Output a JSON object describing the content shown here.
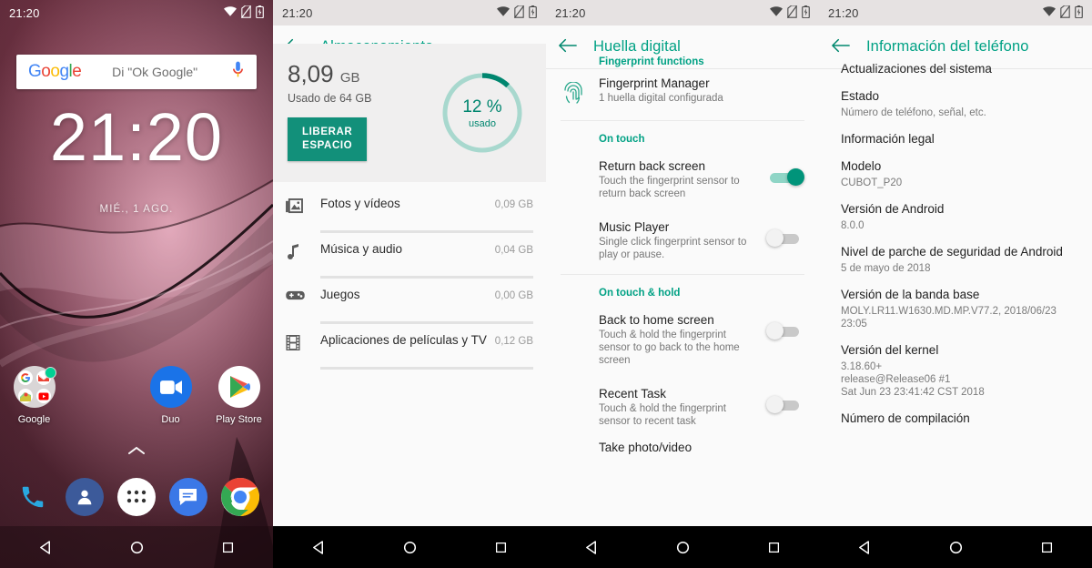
{
  "status_bar": {
    "time": "21:20",
    "icons": [
      "wifi-icon",
      "no-sim-icon",
      "battery-charging-icon"
    ]
  },
  "colors": {
    "accent_teal": "#00a184",
    "accent_teal_dark": "#00866f",
    "button_green": "#12907a",
    "toggle_on": "#00947a",
    "wallpaper_base": "#5c2a38"
  },
  "home_screen": {
    "search": {
      "logo": "Google",
      "placeholder": "Di \"Ok Google\"",
      "mic_icon": "microphone-icon"
    },
    "clock": "21:20",
    "date": "MIÉ., 1 AGO.",
    "apps": [
      {
        "label": "Google",
        "icon": "google-folder-icon"
      },
      {
        "label": "",
        "icon": ""
      },
      {
        "label": "Duo",
        "icon": "duo-icon"
      },
      {
        "label": "Play Store",
        "icon": "play-store-icon"
      }
    ],
    "drawer_arrow": "chevron-up-icon",
    "dock": [
      {
        "icon": "phone-icon",
        "label": "Teléfono"
      },
      {
        "icon": "contacts-icon",
        "label": "Contactos"
      },
      {
        "icon": "app-drawer-icon",
        "label": "Aplicaciones"
      },
      {
        "icon": "messages-icon",
        "label": "Mensajes"
      },
      {
        "icon": "chrome-icon",
        "label": "Chrome"
      }
    ]
  },
  "nav_bar": {
    "back": "back-triangle-icon",
    "home": "home-circle-icon",
    "recents": "recents-square-icon"
  },
  "storage_screen": {
    "back_icon": "back-arrow-icon",
    "title": "Almacenamiento",
    "used_size": "8,09",
    "used_unit": "GB",
    "used_of": "Usado de 64 GB",
    "free_button": "LIBERAR ESPACIO",
    "free_button_line1": "LIBERAR",
    "free_button_line2": "ESPACIO",
    "ring_percent": "12 %",
    "ring_percent_value": 12,
    "ring_label": "usado",
    "categories": [
      {
        "icon": "photos-icon",
        "name": "Fotos y vídeos",
        "size": "0,09 GB"
      },
      {
        "icon": "music-icon",
        "name": "Música y audio",
        "size": "0,04 GB"
      },
      {
        "icon": "games-icon",
        "name": "Juegos",
        "size": "0,00 GB"
      },
      {
        "icon": "movies-icon",
        "name": "Aplicaciones de películas y TV",
        "size": "0,12 GB"
      }
    ]
  },
  "fingerprint_screen": {
    "back_icon": "back-arrow-icon",
    "title": "Huella digital",
    "section_functions": "Fingerprint functions",
    "manager": {
      "icon": "fingerprint-icon",
      "title": "Fingerprint Manager",
      "subtitle": "1 huella digital configurada"
    },
    "section_on_touch": "On touch",
    "section_on_touch_hold": "On touch & hold",
    "items": [
      {
        "title": "Return back screen",
        "subtitle": "Touch the fingerprint sensor to return back screen",
        "toggle": "on"
      },
      {
        "title": "Music Player",
        "subtitle": "Single click fingerprint sensor to play or pause.",
        "toggle": "off"
      },
      {
        "title": "Back to home screen",
        "subtitle": "Touch & hold the fingerprint sensor to go back to the home screen",
        "toggle": "off"
      },
      {
        "title": "Recent Task",
        "subtitle": "Touch & hold the fingerprint sensor to recent task",
        "toggle": "off"
      }
    ],
    "last_partial": "Take photo/video"
  },
  "about_screen": {
    "back_icon": "back-arrow-icon",
    "title": "Información del teléfono",
    "items": [
      {
        "title": "Actualizaciones del sistema",
        "subtitle": ""
      },
      {
        "title": "Estado",
        "subtitle": "Número de teléfono, señal, etc."
      },
      {
        "title": "Información legal",
        "subtitle": ""
      },
      {
        "title": "Modelo",
        "subtitle": "CUBOT_P20"
      },
      {
        "title": "Versión de Android",
        "subtitle": "8.0.0"
      },
      {
        "title": "Nivel de parche de seguridad de Android",
        "subtitle": "5 de mayo de 2018"
      },
      {
        "title": "Versión de la banda base",
        "subtitle": "MOLY.LR11.W1630.MD.MP.V77.2, 2018/06/23 23:05"
      },
      {
        "title": "Versión del kernel",
        "subtitle": "3.18.60+\nrelease@Release06 #1\nSat Jun 23 23:41:42 CST 2018"
      },
      {
        "title": "Número de compilación",
        "subtitle": ""
      }
    ]
  }
}
